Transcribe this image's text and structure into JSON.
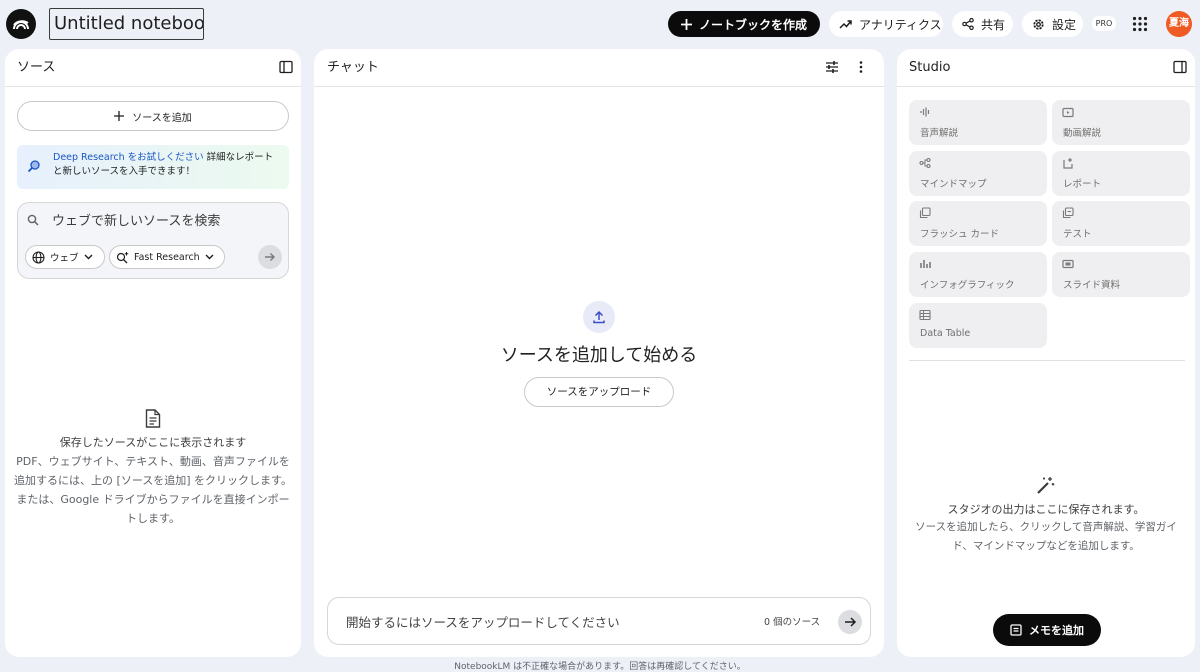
{
  "header": {
    "notebook_title": "Untitled notebook",
    "create_label": "ノートブックを作成",
    "analytics_label": "アナリティクス",
    "share_label": "共有",
    "settings_label": "設定",
    "pro_badge": "PRO",
    "avatar_text": "夏海",
    "avatar_color": "#ef5b24"
  },
  "sources": {
    "title": "ソース",
    "add_label": "ソースを追加",
    "deep_research_link": "Deep Research をお試しください",
    "deep_research_text": " 詳細なレポートと新しいソースを入手できます！",
    "search_placeholder": "ウェブで新しいソースを検索",
    "web_pill": "ウェブ",
    "research_pill": "Fast Research",
    "empty_title": "保存したソースがここに表示されます",
    "empty_body": "PDF、ウェブサイト、テキスト、動画、音声ファイルを追加するには、上の [ソースを追加] をクリックします。または、Google ドライブからファイルを直接インポートします。"
  },
  "chat": {
    "title": "チャット",
    "headline": "ソースを追加して始める",
    "upload_label": "ソースをアップロード",
    "input_placeholder": "開始するにはソースをアップロードしてください",
    "source_count": "0 個のソース"
  },
  "studio": {
    "title": "Studio",
    "tiles": [
      {
        "label": "音声解説",
        "icon": "audio-waveform-icon"
      },
      {
        "label": "動画解説",
        "icon": "video-icon"
      },
      {
        "label": "マインドマップ",
        "icon": "mindmap-icon"
      },
      {
        "label": "レポート",
        "icon": "report-icon"
      },
      {
        "label": "フラッシュ カード",
        "icon": "flashcard-icon"
      },
      {
        "label": "テスト",
        "icon": "quiz-icon"
      },
      {
        "label": "インフォグラフィック",
        "icon": "infographic-icon"
      },
      {
        "label": "スライド資料",
        "icon": "slides-icon"
      },
      {
        "label": "Data Table",
        "icon": "table-icon"
      }
    ],
    "empty_title": "スタジオの出力はここに保存されます。",
    "empty_body": "ソースを追加したら、クリックして音声解説、学習ガイド、マインドマップなどを追加します。",
    "memo_label": "メモを追加"
  },
  "footer": {
    "note": "NotebookLM は不正確な場合があります。回答は再確認してください。"
  }
}
